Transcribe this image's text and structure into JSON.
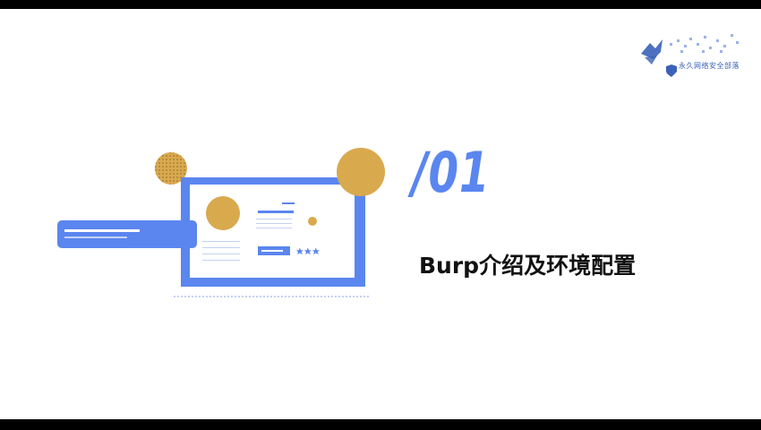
{
  "section": {
    "number": "/01",
    "title": "Burp介绍及环境配置"
  },
  "logo": {
    "name": "永久网络安全部落",
    "icon": "shield-icon"
  },
  "colors": {
    "accent_blue": "#5b86f0",
    "accent_gold": "#d9a94e",
    "text": "#111111",
    "background": "#ffffff"
  }
}
